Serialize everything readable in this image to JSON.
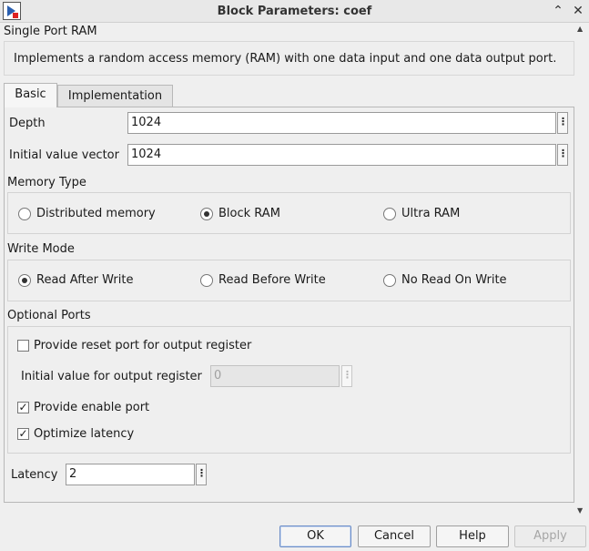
{
  "window": {
    "title": "Block Parameters: coef",
    "collapse_glyph": "⌃",
    "close_glyph": "✕"
  },
  "block": {
    "name": "Single Port RAM",
    "description": "Implements a random access memory (RAM) with one data input and one data output port."
  },
  "tabs": [
    {
      "label": "Basic",
      "active": true
    },
    {
      "label": "Implementation",
      "active": false
    }
  ],
  "params": {
    "depth": {
      "label": "Depth",
      "value": "1024"
    },
    "init_vector": {
      "label": "Initial value vector",
      "value": "1024"
    },
    "menu_glyph": "⋮"
  },
  "memory_type": {
    "label": "Memory Type",
    "options": [
      "Distributed memory",
      "Block RAM",
      "Ultra RAM"
    ],
    "selected": "Block RAM"
  },
  "write_mode": {
    "label": "Write Mode",
    "options": [
      "Read After Write",
      "Read Before Write",
      "No Read On Write"
    ],
    "selected": "Read After Write"
  },
  "optional_ports": {
    "label": "Optional Ports",
    "reset_port": {
      "label": "Provide reset port for output register",
      "checked": false
    },
    "init_output": {
      "label": "Initial value for output register",
      "value": "0",
      "disabled": true
    },
    "enable_port": {
      "label": "Provide enable port",
      "checked": true
    },
    "optimize_latency": {
      "label": "Optimize latency",
      "checked": true
    },
    "check_glyph": "✓"
  },
  "latency": {
    "label": "Latency",
    "value": "2"
  },
  "buttons": {
    "ok": "OK",
    "cancel": "Cancel",
    "help": "Help",
    "apply": "Apply"
  },
  "scroll": {
    "up": "▲",
    "down": "▼"
  }
}
